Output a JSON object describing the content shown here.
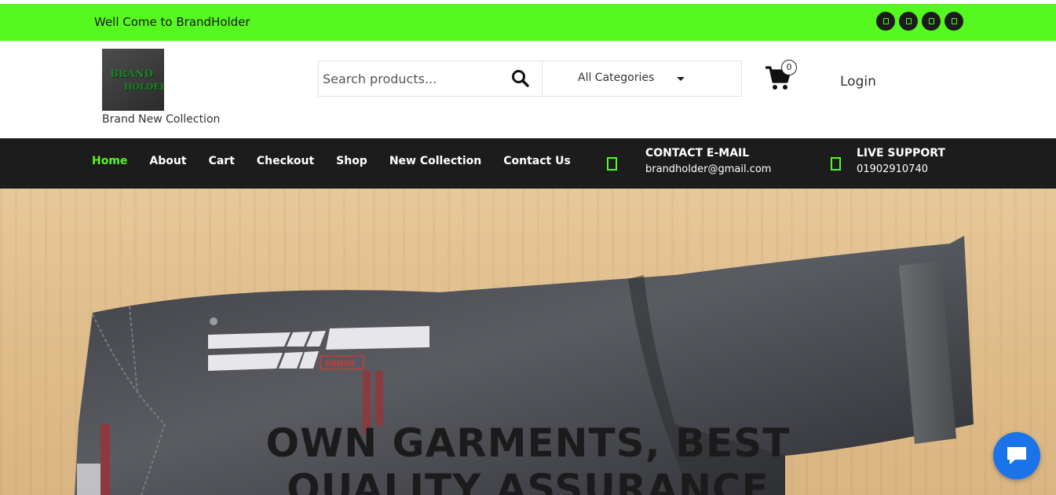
{
  "topbar": {
    "welcome": "Well Come to BrandHolder",
    "social_icons": [
      "social-icon-1",
      "social-icon-2",
      "social-icon-3",
      "social-icon-4"
    ],
    "color": "#55f91f"
  },
  "header": {
    "logo": {
      "line1": "BRAND",
      "line2": "HOLDER"
    },
    "tagline": "Brand New Collection",
    "search": {
      "placeholder": "Search products...",
      "category": "All Categories"
    },
    "cart_count": "0",
    "login": "Login"
  },
  "nav": {
    "items": [
      {
        "label": "Home",
        "active": true
      },
      {
        "label": "About",
        "active": false
      },
      {
        "label": "Cart",
        "active": false
      },
      {
        "label": "Checkout",
        "active": false
      },
      {
        "label": "Shop",
        "active": false
      },
      {
        "label": "New Collection",
        "active": false
      },
      {
        "label": "Contact Us",
        "active": false
      }
    ],
    "email": {
      "title": "CONTACT E-MAIL",
      "value": "brandholder@gmail.com"
    },
    "support": {
      "title": "LIVE SUPPORT",
      "value": "01902910740"
    }
  },
  "hero": {
    "headline_line1": "OWN GARMENTS, BEST",
    "headline_line2": "QUALITY ASSURANCE",
    "print_text": "DENIM"
  },
  "colors": {
    "accent": "#55f91f",
    "nav_bg": "#1b1c1b",
    "chat": "#1a73e8"
  }
}
